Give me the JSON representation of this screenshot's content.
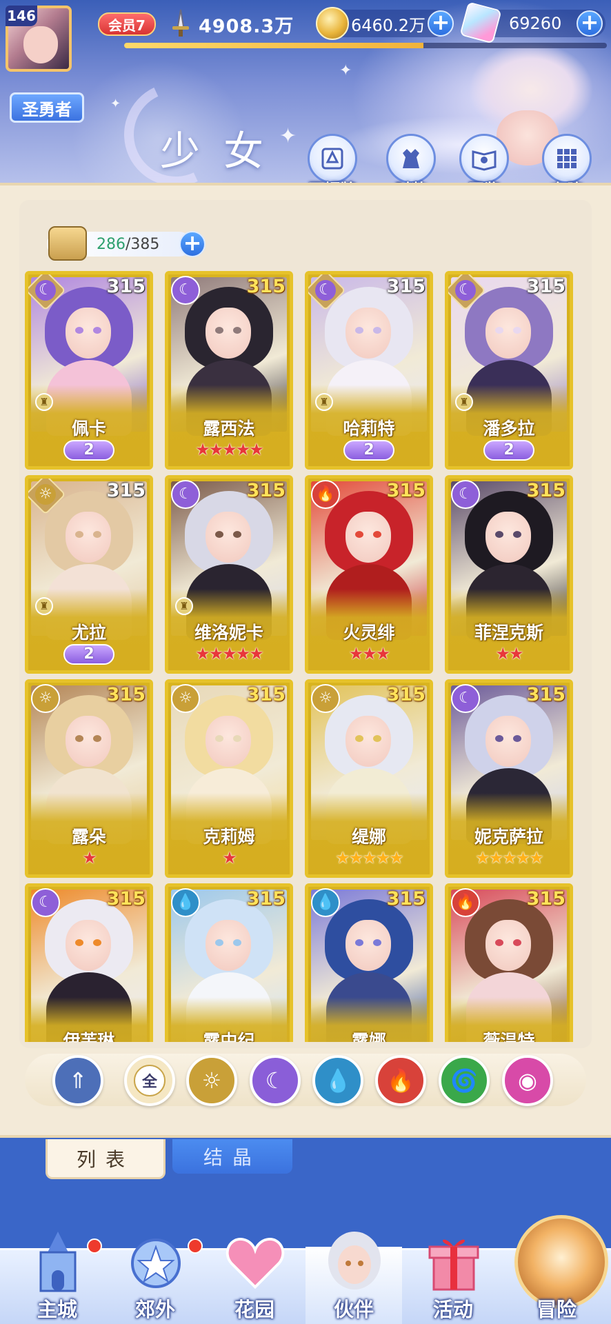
{
  "header": {
    "player_level": "146",
    "title_badge": "圣勇者",
    "vip": "会员7",
    "power": "4908.3万",
    "exp_progress": 0.62,
    "gold": "6460.2万",
    "gems": "69260",
    "page_title": "少女",
    "buttons": [
      "百媚牌",
      "时装",
      "图鉴",
      "布阵"
    ]
  },
  "roster": {
    "owned": "286",
    "capacity": "/385"
  },
  "cards": [
    {
      "name": "佩卡",
      "level": "315",
      "level_color": "white",
      "element": "moon",
      "frame": "diamond",
      "rook": true,
      "rank": "wing",
      "rank_value": "2",
      "palette": [
        "#7b5cc8",
        "#f4c2d8",
        "#b087e0"
      ]
    },
    {
      "name": "露西法",
      "level": "315",
      "level_color": "gold",
      "element": "moon",
      "frame": "circle",
      "rook": false,
      "rank": "stars",
      "stars": 5,
      "star_color": "red",
      "palette": [
        "#2a2530",
        "#3a3040",
        "#8f7a7a"
      ]
    },
    {
      "name": "哈莉特",
      "level": "315",
      "level_color": "white",
      "element": "moon",
      "frame": "diamond",
      "rook": true,
      "rank": "wing",
      "rank_value": "2",
      "palette": [
        "#e8e6f2",
        "#f5f1f8",
        "#c9b8e8"
      ]
    },
    {
      "name": "潘多拉",
      "level": "315",
      "level_color": "white",
      "element": "moon",
      "frame": "diamond",
      "rook": true,
      "rank": "wing",
      "rank_value": "2",
      "palette": [
        "#8e78c2",
        "#3a2f58",
        "#e9d8ef"
      ]
    },
    {
      "name": "尤拉",
      "level": "315",
      "level_color": "white",
      "element": "sun",
      "frame": "diamond",
      "rook": true,
      "rank": "wing",
      "rank_value": "2",
      "palette": [
        "#e3c9a4",
        "#f3e1d6",
        "#d9b48e"
      ]
    },
    {
      "name": "维洛妮卡",
      "level": "315",
      "level_color": "gold",
      "element": "moon",
      "frame": "circle",
      "rook": true,
      "rank": "stars",
      "stars": 5,
      "star_color": "red",
      "palette": [
        "#d8d8e6",
        "#2a2430",
        "#7b5a4a"
      ]
    },
    {
      "name": "火灵绯",
      "level": "315",
      "level_color": "gold",
      "element": "fire",
      "frame": "circle",
      "rook": false,
      "rank": "stars",
      "stars": 3,
      "star_color": "red",
      "palette": [
        "#c8232a",
        "#b01e1e",
        "#e34a3a"
      ]
    },
    {
      "name": "菲涅克斯",
      "level": "315",
      "level_color": "gold",
      "element": "moon",
      "frame": "circle",
      "rook": false,
      "rank": "stars",
      "stars": 2,
      "star_color": "red",
      "palette": [
        "#1e1a22",
        "#2c2530",
        "#5a4a6a"
      ]
    },
    {
      "name": "露朵",
      "level": "315",
      "level_color": "gold",
      "element": "sun",
      "frame": "circle",
      "rook": false,
      "rank": "stars",
      "stars": 1,
      "star_color": "red",
      "palette": [
        "#e8cfa0",
        "#f1e3cf",
        "#b48656"
      ]
    },
    {
      "name": "克莉姆",
      "level": "315",
      "level_color": "gold",
      "element": "sun",
      "frame": "circle",
      "rook": false,
      "rank": "stars",
      "stars": 1,
      "star_color": "red",
      "palette": [
        "#f2dca0",
        "#f7ecd8",
        "#e8d9b8"
      ]
    },
    {
      "name": "缇娜",
      "level": "315",
      "level_color": "gold",
      "element": "sun",
      "frame": "circle",
      "rook": false,
      "rank": "stars",
      "stars": 5,
      "star_color": "gold",
      "palette": [
        "#e6e8f2",
        "#f2ecd4",
        "#e2c35a"
      ]
    },
    {
      "name": "妮克萨拉",
      "level": "315",
      "level_color": "gold",
      "element": "moon",
      "frame": "circle",
      "rook": false,
      "rank": "stars",
      "stars": 5,
      "star_color": "gold",
      "palette": [
        "#cfd2ea",
        "#2b2736",
        "#6b5a9a"
      ]
    },
    {
      "name": "伊芙琳",
      "level": "315",
      "level_color": "gold",
      "element": "moon",
      "frame": "circle",
      "rook": false,
      "rank": "none",
      "palette": [
        "#eceaf2",
        "#2a2230",
        "#ee8a2a"
      ]
    },
    {
      "name": "露中纪",
      "level": "315",
      "level_color": "gold",
      "element": "water",
      "frame": "circle",
      "rook": false,
      "rank": "none",
      "palette": [
        "#cfe2f6",
        "#f4f6fa",
        "#9cc8ec"
      ]
    },
    {
      "name": "露娜",
      "level": "315",
      "level_color": "gold",
      "element": "water",
      "frame": "circle",
      "rook": false,
      "rank": "none",
      "palette": [
        "#2e4ea0",
        "#3a4a8e",
        "#7b7ad8"
      ]
    },
    {
      "name": "薇温特",
      "level": "315",
      "level_color": "gold",
      "element": "fire",
      "frame": "circle",
      "rook": false,
      "rank": "none",
      "palette": [
        "#7a4a36",
        "#f3d5d8",
        "#d84a5a"
      ]
    }
  ],
  "filters": [
    {
      "name": "filter-all-elements",
      "label": "",
      "color": "#4d6fb8",
      "glyph": "⇑"
    },
    {
      "name": "filter-all",
      "label": "全",
      "color": "#f5e7c3",
      "glyph": ""
    },
    {
      "name": "filter-sun",
      "label": "",
      "color": "#c9a038",
      "glyph": "☼"
    },
    {
      "name": "filter-moon",
      "label": "",
      "color": "#8a5ed8",
      "glyph": "☾"
    },
    {
      "name": "filter-water",
      "label": "",
      "color": "#2f8fc8",
      "glyph": "💧"
    },
    {
      "name": "filter-fire",
      "label": "",
      "color": "#d8423a",
      "glyph": "🔥"
    },
    {
      "name": "filter-wind",
      "label": "",
      "color": "#3aa84a",
      "glyph": "🌀"
    },
    {
      "name": "filter-dark",
      "label": "",
      "color": "#d84aa8",
      "glyph": "◉"
    }
  ],
  "tabs": {
    "list": "列表",
    "crystal": "结晶"
  },
  "nav": [
    {
      "label": "主城",
      "badge": true
    },
    {
      "label": "郊外",
      "badge": true
    },
    {
      "label": "花园",
      "badge": false
    },
    {
      "label": "伙伴",
      "badge": false
    },
    {
      "label": "活动",
      "badge": false
    },
    {
      "label": "冒险",
      "badge": false
    }
  ],
  "element_colors": {
    "moon": "#8e5fd8",
    "sun": "#c9a038",
    "fire": "#d8423a",
    "water": "#2f8fc8"
  }
}
